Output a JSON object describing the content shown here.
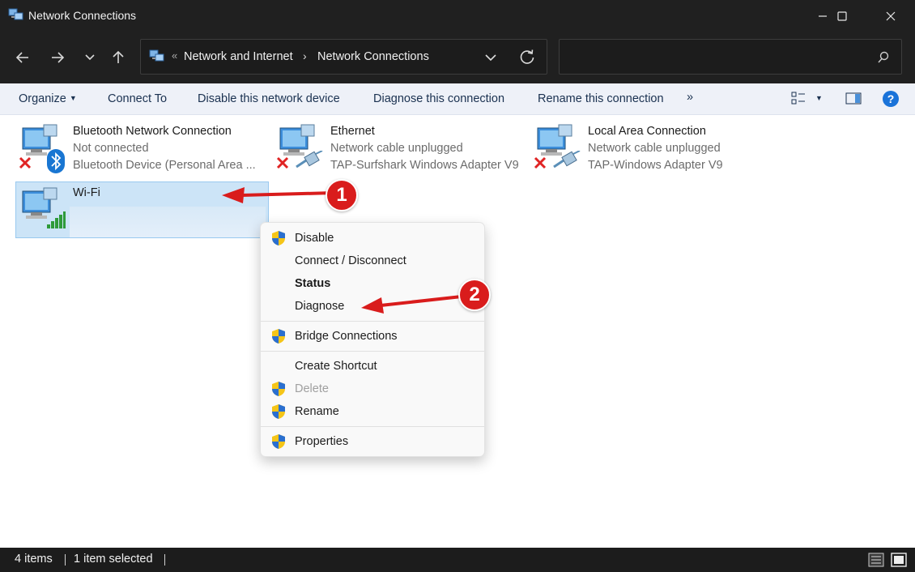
{
  "window": {
    "title": "Network Connections",
    "controls": [
      "minimize-icon",
      "maximize-icon",
      "close-icon"
    ]
  },
  "nav": {
    "back_icon": "arrow-left-icon",
    "forward_icon": "arrow-right-icon",
    "recent_icon": "chevron-down-icon",
    "up_icon": "arrow-up-icon",
    "address": {
      "overflow_chevron": "«",
      "crumbs": [
        "Network and Internet",
        "Network Connections"
      ],
      "separator": "›"
    },
    "search": {
      "placeholder": "",
      "value": ""
    }
  },
  "commands": {
    "organize": "Organize",
    "connect_to": "Connect To",
    "disable": "Disable this network device",
    "diagnose": "Diagnose this connection",
    "rename": "Rename this connection",
    "more": "»"
  },
  "connections": [
    {
      "name": "Bluetooth Network Connection",
      "status": "Not connected",
      "device": "Bluetooth Device (Personal Area ...",
      "overlay": "bluetooth-icon",
      "error": true
    },
    {
      "name": "Ethernet",
      "status": "Network cable unplugged",
      "device": "TAP-Surfshark Windows Adapter V9",
      "overlay": "network-cable-icon",
      "error": true
    },
    {
      "name": "Local Area Connection",
      "status": "Network cable unplugged",
      "device": "TAP-Windows Adapter V9",
      "overlay": "network-cable-icon",
      "error": true
    },
    {
      "name": "Wi-Fi",
      "status": "",
      "device": "",
      "overlay": "wifi-signal-icon",
      "error": false,
      "selected": true
    }
  ],
  "context_menu": {
    "items": [
      {
        "label": "Disable",
        "shield": true
      },
      {
        "label": "Connect / Disconnect",
        "shield": false
      },
      {
        "label": "Status",
        "shield": false,
        "bold": true
      },
      {
        "label": "Diagnose",
        "shield": false
      },
      {
        "label": "Bridge Connections",
        "shield": true
      },
      {
        "label": "Create Shortcut",
        "shield": false
      },
      {
        "label": "Delete",
        "shield": true,
        "disabled": true
      },
      {
        "label": "Rename",
        "shield": true
      },
      {
        "label": "Properties",
        "shield": true
      }
    ]
  },
  "annotations": {
    "step1": "1",
    "step2": "2",
    "color": "#d91c1c"
  },
  "statusbar": {
    "items_count": "4 items",
    "selected": "1 item selected"
  },
  "colors": {
    "accent": "#0067c0",
    "selection": "#cce4f7",
    "titlebar": "#202020"
  }
}
